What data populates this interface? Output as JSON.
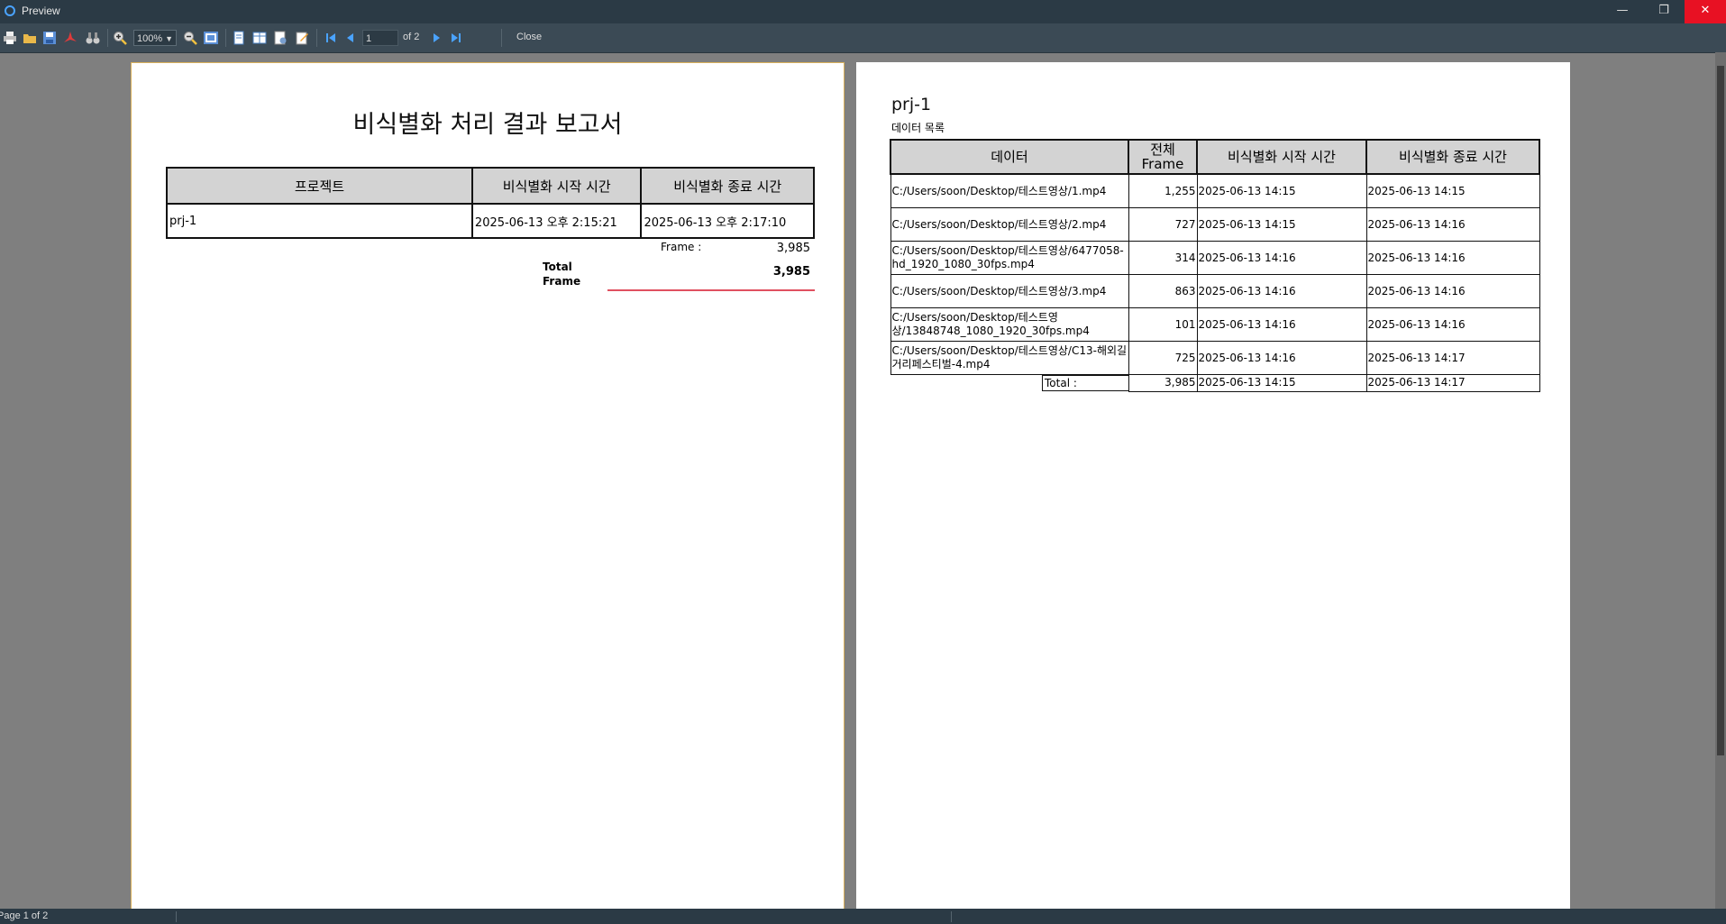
{
  "window": {
    "title": "Preview"
  },
  "toolbar": {
    "zoom": "100%",
    "page_current": "1",
    "page_of": "of 2",
    "close_label": "Close"
  },
  "page1": {
    "title": "비식별화 처리 결과 보고서",
    "headers": [
      "프로젝트",
      "비식별화 시작 시간",
      "비식별화 종료 시간"
    ],
    "rows": [
      [
        "prj-1",
        "2025-06-13 오후 2:15:21",
        "2025-06-13 오후 2:17:10"
      ]
    ],
    "frame_label": "Frame :",
    "frame_value": "3,985",
    "total_label": "Total Frame",
    "total_value": "3,985"
  },
  "page2": {
    "project": "prj-1",
    "subtitle": "데이터 목록",
    "headers": [
      "데이터",
      "전체 Frame",
      "비식별화 시작 시간",
      "비식별화 종료 시간"
    ],
    "rows": [
      [
        "C:/Users/soon/Desktop/테스트영상/1.mp4",
        "1,255",
        "2025-06-13 14:15",
        "2025-06-13 14:15"
      ],
      [
        "C:/Users/soon/Desktop/테스트영상/2.mp4",
        "727",
        "2025-06-13 14:15",
        "2025-06-13 14:16"
      ],
      [
        "C:/Users/soon/Desktop/테스트영상/6477058-hd_1920_1080_30fps.mp4",
        "314",
        "2025-06-13 14:16",
        "2025-06-13 14:16"
      ],
      [
        "C:/Users/soon/Desktop/테스트영상/3.mp4",
        "863",
        "2025-06-13 14:16",
        "2025-06-13 14:16"
      ],
      [
        "C:/Users/soon/Desktop/테스트영상/13848748_1080_1920_30fps.mp4",
        "101",
        "2025-06-13 14:16",
        "2025-06-13 14:16"
      ],
      [
        "C:/Users/soon/Desktop/테스트영상/C13-해외길거리페스티벌-4.mp4",
        "725",
        "2025-06-13 14:16",
        "2025-06-13 14:17"
      ]
    ],
    "total": {
      "label": "Total :",
      "frames": "3,985",
      "start": "2025-06-13 14:15",
      "end": "2025-06-13 14:17"
    }
  },
  "status": {
    "text": "Page 1 of 2"
  }
}
